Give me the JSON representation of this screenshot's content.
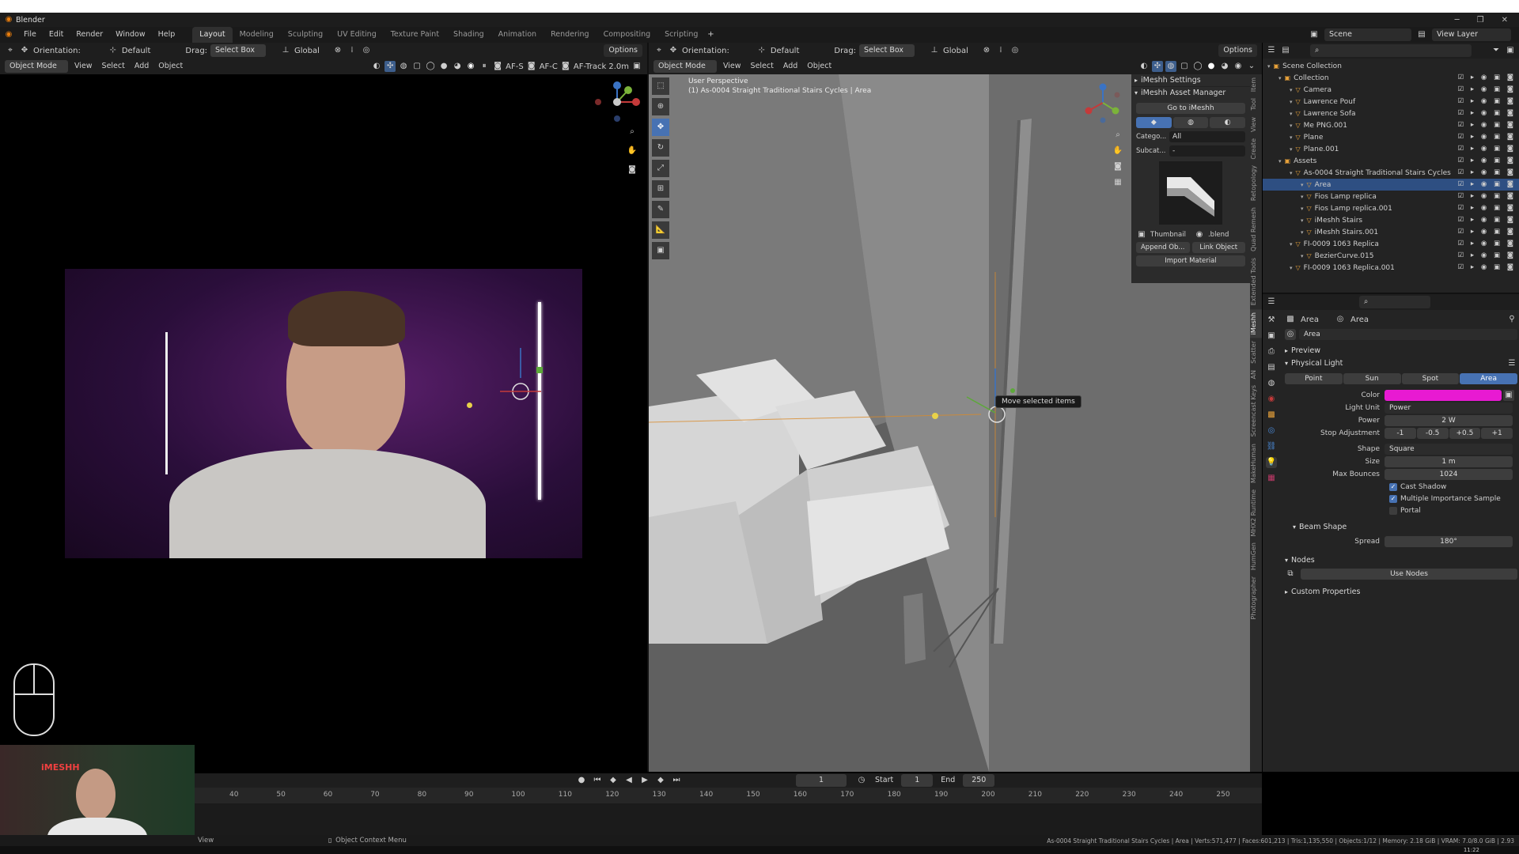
{
  "app": {
    "title": "Blender"
  },
  "menu": [
    "File",
    "Edit",
    "Render",
    "Window",
    "Help"
  ],
  "workspaces": [
    {
      "label": "Layout",
      "active": true
    },
    {
      "label": "Modeling"
    },
    {
      "label": "Sculpting"
    },
    {
      "label": "UV Editing"
    },
    {
      "label": "Texture Paint"
    },
    {
      "label": "Shading"
    },
    {
      "label": "Animation"
    },
    {
      "label": "Rendering"
    },
    {
      "label": "Compositing"
    },
    {
      "label": "Scripting"
    }
  ],
  "scene": {
    "name": "Scene",
    "view_layer": "View Layer"
  },
  "left_tools": {
    "orientation_label": "Orientation:",
    "orientation_value": "Default",
    "drag_label": "Drag:",
    "drag_value": "Select Box",
    "transform_value": "Global",
    "options": "Options"
  },
  "left_header": {
    "mode": "Object Mode",
    "menus": [
      "View",
      "Select",
      "Add",
      "Object"
    ],
    "af_s": "AF-S",
    "af_c": "AF-C",
    "af_track": "AF-Track",
    "distance": "2.0m"
  },
  "vp_tools": {
    "orientation_label": "Orientation:",
    "orientation_value": "Default",
    "drag_label": "Drag:",
    "drag_value": "Select Box",
    "transform_value": "Global",
    "options": "Options"
  },
  "vp_header": {
    "mode": "Object Mode",
    "menus": [
      "View",
      "Select",
      "Add",
      "Object"
    ]
  },
  "viewport": {
    "perspective": "User Perspective",
    "info": "(1) As-0004 Straight Traditional Stairs Cycles | Area",
    "tooltip": "Move selected items"
  },
  "imeshh": {
    "settings": "iMeshh Settings",
    "asset_manager": "iMeshh Asset Manager",
    "go_to": "Go to iMeshh",
    "category_label": "Catego...",
    "category_value": "All",
    "subcategory_label": "Subcat...",
    "subcategory_value": "-",
    "thumbnail": "Thumbnail",
    "blend": ".blend",
    "append": "Append Ob...",
    "link": "Link Object",
    "import_material": "Import Material"
  },
  "side_tabs": [
    "Item",
    "Tool",
    "View",
    "Create",
    "Retopology",
    "Quad Remesh",
    "Extended Tools",
    "iMeshh",
    "Scatter",
    "AN",
    "Screencast Keys",
    "MakeHuman",
    "MHX2 Runtime",
    "HumGen",
    "Photographer"
  ],
  "outliner": {
    "rows": [
      {
        "label": "Scene Collection",
        "indent": 0
      },
      {
        "label": "Collection",
        "indent": 1
      },
      {
        "label": "Camera",
        "indent": 2
      },
      {
        "label": "Lawrence Pouf",
        "indent": 2
      },
      {
        "label": "Lawrence Sofa",
        "indent": 2
      },
      {
        "label": "Me PNG.001",
        "indent": 2
      },
      {
        "label": "Plane",
        "indent": 2
      },
      {
        "label": "Plane.001",
        "indent": 2
      },
      {
        "label": "Assets",
        "indent": 1
      },
      {
        "label": "As-0004 Straight Traditional Stairs Cycles",
        "indent": 2
      },
      {
        "label": "Area",
        "indent": 3,
        "selected": true
      },
      {
        "label": "Fios Lamp replica",
        "indent": 3
      },
      {
        "label": "Fios Lamp replica.001",
        "indent": 3
      },
      {
        "label": "iMeshh Stairs",
        "indent": 3
      },
      {
        "label": "iMeshh Stairs.001",
        "indent": 3
      },
      {
        "label": "FI-0009 1063 Replica",
        "indent": 2
      },
      {
        "label": "BezierCurve.015",
        "indent": 3
      },
      {
        "label": "FI-0009 1063 Replica.001",
        "indent": 2
      }
    ]
  },
  "properties": {
    "header_left": "Area",
    "header_right": "Area",
    "datablock": "Area",
    "preview": "Preview",
    "physical_light": "Physical Light",
    "light_types": [
      "Point",
      "Sun",
      "Spot",
      "Area"
    ],
    "active_type": "Area",
    "color_label": "Color",
    "color_hex": "#e81ad2",
    "light_unit_label": "Light Unit",
    "light_unit": "Power",
    "power_label": "Power",
    "power": "2 W",
    "stop_label": "Stop Adjustment",
    "stops": [
      "-1",
      "-0.5",
      "+0.5",
      "+1"
    ],
    "shape_label": "Shape",
    "shape": "Square",
    "size_label": "Size",
    "size": "1 m",
    "bounces_label": "Max Bounces",
    "bounces": "1024",
    "cast_shadow": "Cast Shadow",
    "mis": "Multiple Importance Sample",
    "portal": "Portal",
    "beam_shape": "Beam Shape",
    "spread_label": "Spread",
    "spread": "180°",
    "nodes": "Nodes",
    "use_nodes": "Use Nodes",
    "custom_properties": "Custom Properties"
  },
  "timeline": {
    "current_frame": "1",
    "start_label": "Start",
    "start": "1",
    "end_label": "End",
    "end": "250",
    "ticks": [
      "40",
      "50",
      "60",
      "70",
      "80",
      "90",
      "100",
      "110",
      "120",
      "130",
      "140",
      "150",
      "160",
      "170",
      "180",
      "190",
      "200",
      "210",
      "220",
      "230",
      "240",
      "250"
    ]
  },
  "status": {
    "left": "View",
    "context": "Object Context Menu",
    "right": "As-0004 Straight Traditional Stairs Cycles | Area | Verts:571,477 | Faces:601,213 | Tris:1,135,550 | Objects:1/12 | Memory: 2.18 GiB | VRAM: 7.0/8.0 GiB | 2.93",
    "clock": "11:22"
  },
  "webcam_logo": "iMESHH"
}
